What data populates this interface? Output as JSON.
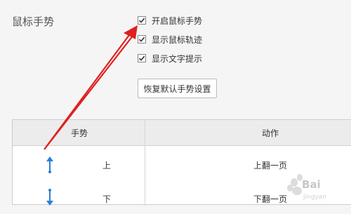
{
  "section": {
    "title": "鼠标手势"
  },
  "options": [
    {
      "label": "开启鼠标手势",
      "checked": true
    },
    {
      "label": "显示鼠标轨迹",
      "checked": true
    },
    {
      "label": "显示文字提示",
      "checked": true
    }
  ],
  "reset_button": {
    "label": "恢复默认手势设置"
  },
  "table": {
    "headers": {
      "gesture": "手势",
      "action": "动作"
    },
    "rows": [
      {
        "icon": "arrow-up-icon",
        "direction": "上",
        "action": "上翻一页"
      },
      {
        "icon": "arrow-down-icon",
        "direction": "下",
        "action": "下翻一页"
      }
    ]
  },
  "watermark": {
    "text": "Bai",
    "sub": "jingyan"
  },
  "colors": {
    "annotation_arrow": "#e02020",
    "gesture_arrow": "#2a7fd4",
    "header_bg": "#ececec"
  }
}
